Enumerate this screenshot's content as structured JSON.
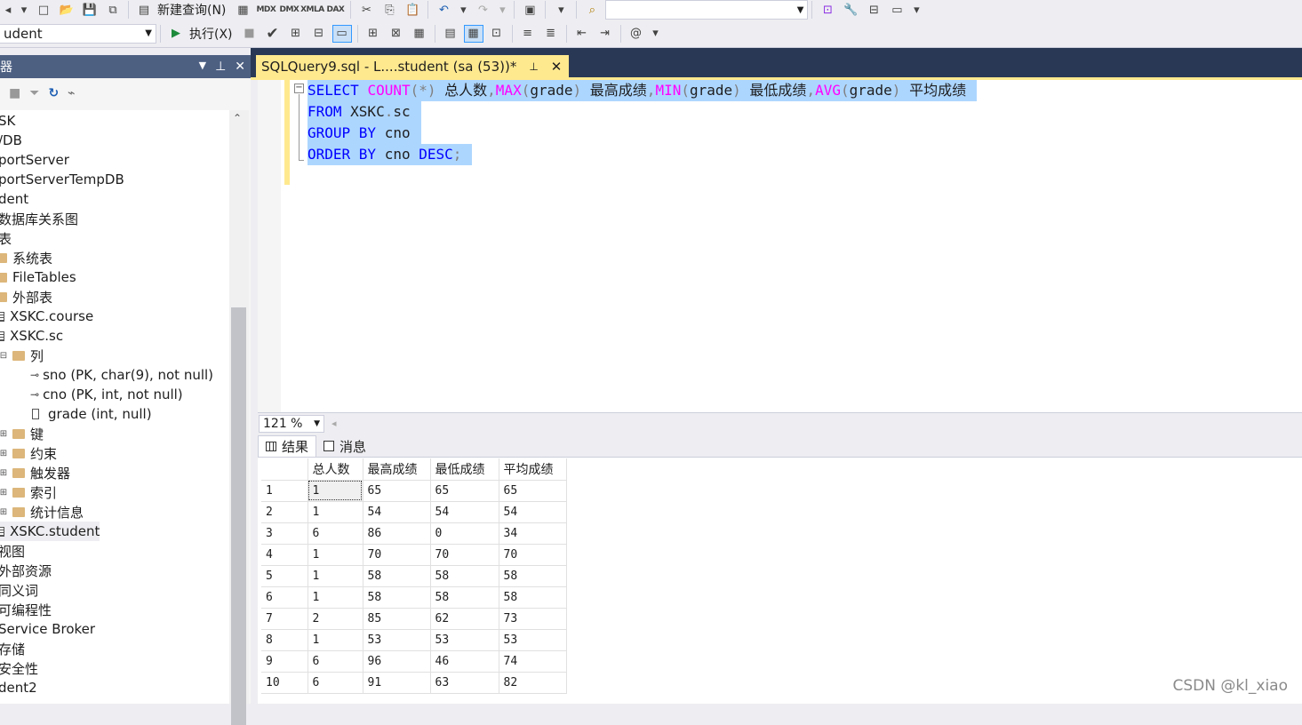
{
  "toolbar1": {
    "new_query_label": "新建查询(N)",
    "mdx": "MDX",
    "dmx": "DMX",
    "xmla": "XMLA",
    "dax": "DAX"
  },
  "toolbar2": {
    "database": "udent",
    "execute_label": "执行(X)"
  },
  "object_explorer": {
    "title": "器",
    "tree": [
      {
        "label": "SK",
        "indent": 0,
        "icon": "none"
      },
      {
        "label": "/DB",
        "indent": 0,
        "icon": "none"
      },
      {
        "label": "portServer",
        "indent": 0,
        "icon": "none"
      },
      {
        "label": "portServerTempDB",
        "indent": 0,
        "icon": "none"
      },
      {
        "label": "dent",
        "indent": 0,
        "icon": "none"
      },
      {
        "label": "数据库关系图",
        "indent": 0,
        "icon": "none"
      },
      {
        "label": "表",
        "indent": 0,
        "icon": "none"
      },
      {
        "label": "系统表",
        "indent": 1,
        "icon": "folder"
      },
      {
        "label": "FileTables",
        "indent": 1,
        "icon": "folder"
      },
      {
        "label": "外部表",
        "indent": 1,
        "icon": "folder"
      },
      {
        "label": "XSKC.course",
        "indent": 1,
        "icon": "table"
      },
      {
        "label": "XSKC.sc",
        "indent": 1,
        "icon": "table"
      },
      {
        "label": "列",
        "indent": 2,
        "icon": "folder"
      },
      {
        "label": "sno (PK, char(9), not null)",
        "indent": 3,
        "icon": "key"
      },
      {
        "label": "cno (PK, int, not null)",
        "indent": 3,
        "icon": "key"
      },
      {
        "label": "grade (int, null)",
        "indent": 3,
        "icon": "column"
      },
      {
        "label": "键",
        "indent": 2,
        "icon": "folder"
      },
      {
        "label": "约束",
        "indent": 2,
        "icon": "folder"
      },
      {
        "label": "触发器",
        "indent": 2,
        "icon": "folder"
      },
      {
        "label": "索引",
        "indent": 2,
        "icon": "folder"
      },
      {
        "label": "统计信息",
        "indent": 2,
        "icon": "folder"
      },
      {
        "label": "XSKC.student",
        "indent": 1,
        "icon": "table"
      },
      {
        "label": "视图",
        "indent": 0,
        "icon": "none"
      },
      {
        "label": "外部资源",
        "indent": 0,
        "icon": "none"
      },
      {
        "label": "同义词",
        "indent": 0,
        "icon": "none"
      },
      {
        "label": "可编程性",
        "indent": 0,
        "icon": "none"
      },
      {
        "label": "Service Broker",
        "indent": 0,
        "icon": "none"
      },
      {
        "label": "存储",
        "indent": 0,
        "icon": "none"
      },
      {
        "label": "安全性",
        "indent": 0,
        "icon": "none"
      },
      {
        "label": "dent2",
        "indent": 0,
        "icon": "none"
      }
    ]
  },
  "tab": {
    "title": "SQLQuery9.sql - L....student (sa (53))*"
  },
  "editor": {
    "l1": {
      "kw1": "SELECT",
      "f1": "COUNT",
      "a1": "(*)",
      "t1": " 总人数",
      "c1": ",",
      "f2": "MAX",
      "p1": "(",
      "t2": "grade",
      "p2": ")",
      "t3": " 最高成绩",
      "c2": ",",
      "f3": "MIN",
      "p3": "(",
      "t4": "grade",
      "p4": ")",
      "t5": " 最低成绩",
      "c3": ",",
      "f4": "AVG",
      "p5": "(",
      "t6": "grade",
      "p6": ")",
      "t7": " 平均成绩"
    },
    "l2": {
      "kw": "FROM",
      "t1": " XSKC",
      "d": ".",
      "t2": "sc"
    },
    "l3": {
      "kw": "GROUP BY",
      "t": " cno"
    },
    "l4": {
      "kw": "ORDER BY",
      "t": " cno ",
      "kw2": "DESC",
      "s": ";"
    }
  },
  "zoom": "121 %",
  "results_tabs": {
    "results": "结果",
    "messages": "消息"
  },
  "grid": {
    "headers": [
      "总人数",
      "最高成绩",
      "最低成绩",
      "平均成绩"
    ],
    "rows": [
      [
        "1",
        "1",
        "65",
        "65",
        "65"
      ],
      [
        "2",
        "1",
        "54",
        "54",
        "54"
      ],
      [
        "3",
        "6",
        "86",
        "0",
        "34"
      ],
      [
        "4",
        "1",
        "70",
        "70",
        "70"
      ],
      [
        "5",
        "1",
        "58",
        "58",
        "58"
      ],
      [
        "6",
        "1",
        "58",
        "58",
        "58"
      ],
      [
        "7",
        "2",
        "85",
        "62",
        "73"
      ],
      [
        "8",
        "1",
        "53",
        "53",
        "53"
      ],
      [
        "9",
        "6",
        "96",
        "46",
        "74"
      ],
      [
        "10",
        "6",
        "91",
        "63",
        "82"
      ]
    ]
  },
  "watermark": "CSDN @kl_xiao"
}
